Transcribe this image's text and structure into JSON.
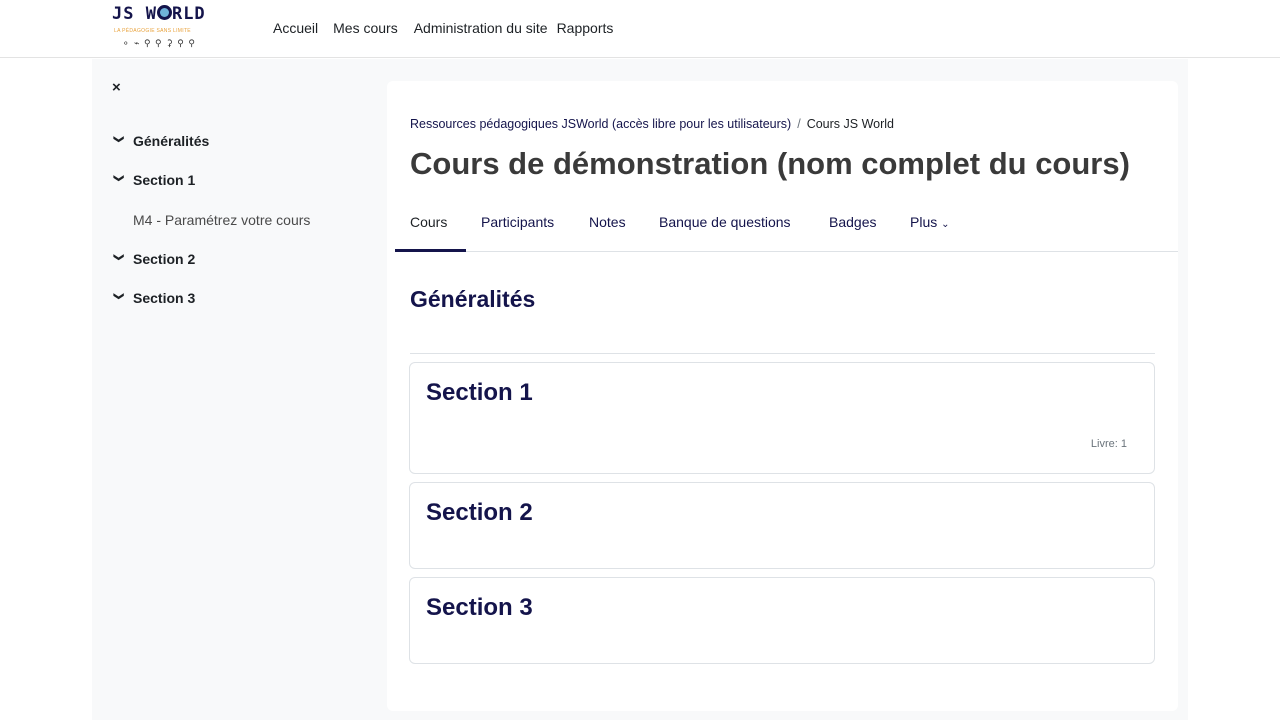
{
  "logo": {
    "text_before": "JS W",
    "text_after": "RLD",
    "tagline": "LA PÉDAGOGIE SANS LIMITE",
    "figures": "🚴🏊🤸🏃🧗🏋🏇"
  },
  "nav": {
    "links": [
      "Accueil",
      "Mes cours",
      "Administration du site",
      "Rapports"
    ]
  },
  "drawer": {
    "close_icon": "×",
    "items": [
      {
        "label": "Généralités"
      },
      {
        "label": "Section 1"
      },
      {
        "label": "M4 - Paramétrez votre cours"
      },
      {
        "label": "Section 2"
      },
      {
        "label": "Section 3"
      }
    ]
  },
  "breadcrumb": {
    "parent": "Ressources pédagogiques JSWorld (accès libre pour les utilisateurs)",
    "separator": "/",
    "current": "Cours JS World"
  },
  "page_title": "Cours de démonstration (nom complet du cours)",
  "tabs": [
    {
      "label": "Cours"
    },
    {
      "label": "Participants"
    },
    {
      "label": "Notes"
    },
    {
      "label": "Banque de questions"
    },
    {
      "label": "Badges"
    },
    {
      "label": "Plus"
    }
  ],
  "content": {
    "general_title": "Généralités",
    "sections": [
      {
        "title": "Section 1",
        "activity": "Livre: 1"
      },
      {
        "title": "Section 2"
      },
      {
        "title": "Section 3"
      }
    ]
  },
  "colors": {
    "brand_navy": "#14144b",
    "drawer_bg": "#f8f9fa",
    "border": "#dee2e6"
  }
}
